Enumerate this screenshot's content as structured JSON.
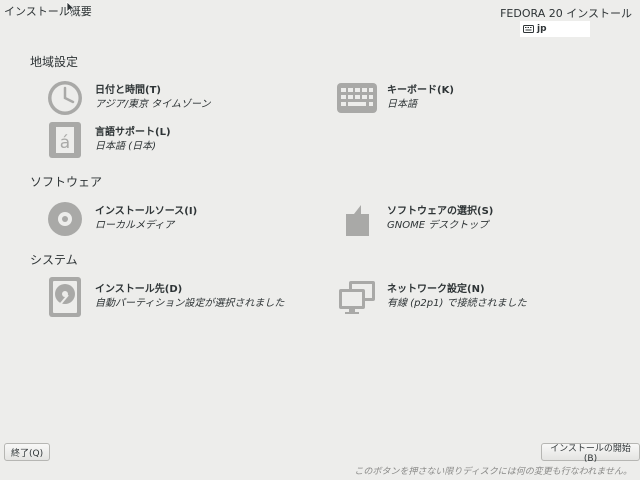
{
  "header": {
    "title": "インストール概要",
    "product": "FEDORA 20 インストール",
    "keyboard_layout": "jp"
  },
  "sections": {
    "localization": "地域設定",
    "software": "ソフトウェア",
    "system": "システム"
  },
  "spokes": {
    "datetime": {
      "title": "日付と時間(T)",
      "status": "アジア/東京 タイムゾーン",
      "icon": "clock-icon"
    },
    "keyboard": {
      "title": "キーボード(K)",
      "status": "日本語",
      "icon": "keyboard-icon"
    },
    "language": {
      "title": "言語サポート(L)",
      "status": "日本語 (日本)",
      "icon": "language-icon"
    },
    "source": {
      "title": "インストールソース(I)",
      "status": "ローカルメディア",
      "icon": "disc-icon"
    },
    "software": {
      "title": "ソフトウェアの選択(S)",
      "status": "GNOME デスクトップ",
      "icon": "package-icon"
    },
    "destination": {
      "title": "インストール先(D)",
      "status": "自動パーティション設定が選択されました",
      "icon": "harddisk-icon"
    },
    "network": {
      "title": "ネットワーク設定(N)",
      "status": "有線 (p2p1) で接続されました",
      "icon": "network-icon"
    }
  },
  "footer": {
    "quit_label": "終了(Q)",
    "begin_label": "インストールの開始(B)",
    "note": "このボタンを押さない限りディスクには何の変更も行なわれません。"
  },
  "colors": {
    "background": "#ededeb",
    "icon": "#a9a9a7",
    "text": "#2e3436",
    "note": "#8a8a88"
  }
}
